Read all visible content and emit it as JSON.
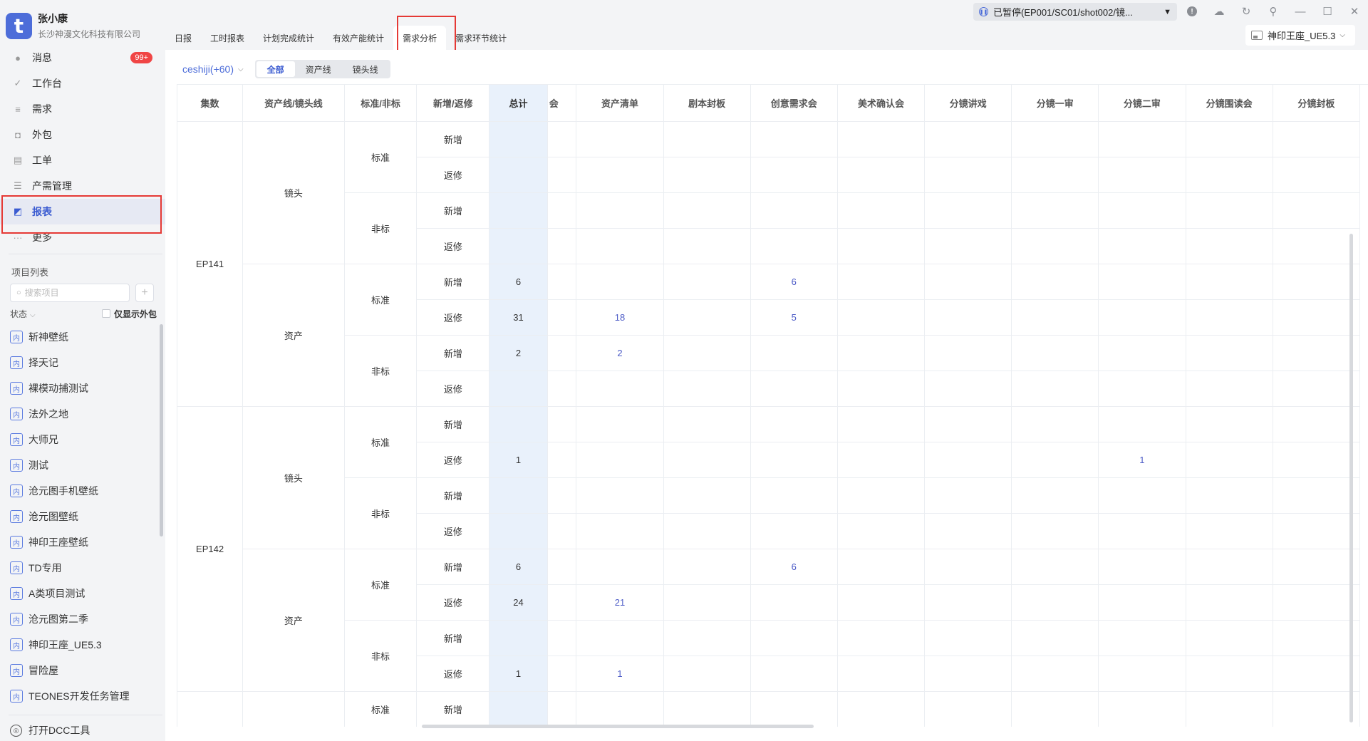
{
  "user": {
    "name": "张小康",
    "company": "长沙神漫文化科技有限公司",
    "logo_letter": "t"
  },
  "nav": [
    {
      "label": "消息",
      "icon": "message-icon",
      "badge": "99+"
    },
    {
      "label": "工作台",
      "icon": "check-icon"
    },
    {
      "label": "需求",
      "icon": "requirement-icon"
    },
    {
      "label": "外包",
      "icon": "outsource-icon"
    },
    {
      "label": "工单",
      "icon": "ticket-icon"
    },
    {
      "label": "产需管理",
      "icon": "production-icon"
    },
    {
      "label": "报表",
      "icon": "report-icon",
      "active": true
    },
    {
      "label": "更多",
      "icon": "more-icon"
    }
  ],
  "projects_panel": {
    "title": "项目列表",
    "search_placeholder": "搜索项目",
    "status_label": "状态",
    "only_outsource_label": "仅显示外包",
    "tag": "内",
    "items": [
      "斩神壁纸",
      "择天记",
      "裸模动捕测试",
      "法外之地",
      "大师兄",
      "测试",
      "沧元图手机壁纸",
      "沧元图壁纸",
      "神印王座壁纸",
      "TD专用",
      "A类项目测试",
      "沧元图第二季",
      "神印王座_UE5.3",
      "冒险屋",
      "TEONES开发任务管理"
    ]
  },
  "dcc_label": "打开DCC工具",
  "titlebar": {
    "task_status": "已暂停(EP001/SC01/shot002/镜..."
  },
  "tabs": [
    {
      "label": "日报"
    },
    {
      "label": "工时报表"
    },
    {
      "label": "计划完成统计"
    },
    {
      "label": "有效产能统计"
    },
    {
      "label": "需求分析",
      "active": true
    },
    {
      "label": "需求环节统计"
    }
  ],
  "project_select": "神印王座_UE5.3",
  "toolbar": {
    "dataset": "ceshiji(+60)",
    "segments": [
      {
        "label": "全部",
        "active": true
      },
      {
        "label": "资产线"
      },
      {
        "label": "镜头线"
      }
    ]
  },
  "table": {
    "headers": [
      "集数",
      "资产线/镜头线",
      "标准/非标",
      "新增/返修",
      "总计",
      "会",
      "资产清单",
      "剧本封板",
      "创意需求会",
      "美术确认会",
      "分镜讲戏",
      "分镜一审",
      "分镜二审",
      "分镜围读会",
      "分镜封板"
    ],
    "groups": [
      {
        "episode": "EP141",
        "lines": [
          {
            "line": "镜头",
            "stds": [
              {
                "std": "标准",
                "rows": [
                  {
                    "type": "新增",
                    "vals": [
                      "",
                      "",
                      "",
                      "",
                      "",
                      "",
                      "",
                      "",
                      "",
                      "",
                      ""
                    ]
                  },
                  {
                    "type": "返修",
                    "vals": [
                      "",
                      "",
                      "",
                      "",
                      "",
                      "",
                      "",
                      "",
                      "",
                      "",
                      ""
                    ]
                  }
                ]
              },
              {
                "std": "非标",
                "rows": [
                  {
                    "type": "新增",
                    "vals": [
                      "",
                      "",
                      "",
                      "",
                      "",
                      "",
                      "",
                      "",
                      "",
                      "",
                      ""
                    ]
                  },
                  {
                    "type": "返修",
                    "vals": [
                      "",
                      "",
                      "",
                      "",
                      "",
                      "",
                      "",
                      "",
                      "",
                      "",
                      ""
                    ]
                  }
                ]
              }
            ]
          },
          {
            "line": "资产",
            "stds": [
              {
                "std": "标准",
                "rows": [
                  {
                    "type": "新增",
                    "vals": [
                      "6",
                      "",
                      "",
                      "",
                      "6",
                      "",
                      "",
                      "",
                      "",
                      "",
                      ""
                    ]
                  },
                  {
                    "type": "返修",
                    "vals": [
                      "31",
                      "",
                      "18",
                      "",
                      "5",
                      "",
                      "",
                      "",
                      "",
                      "",
                      ""
                    ]
                  }
                ]
              },
              {
                "std": "非标",
                "rows": [
                  {
                    "type": "新增",
                    "vals": [
                      "2",
                      "",
                      "2",
                      "",
                      "",
                      "",
                      "",
                      "",
                      "",
                      "",
                      ""
                    ]
                  },
                  {
                    "type": "返修",
                    "vals": [
                      "",
                      "",
                      "",
                      "",
                      "",
                      "",
                      "",
                      "",
                      "",
                      "",
                      ""
                    ]
                  }
                ]
              }
            ]
          }
        ]
      },
      {
        "episode": "EP142",
        "lines": [
          {
            "line": "镜头",
            "stds": [
              {
                "std": "标准",
                "rows": [
                  {
                    "type": "新增",
                    "vals": [
                      "",
                      "",
                      "",
                      "",
                      "",
                      "",
                      "",
                      "",
                      "",
                      "",
                      ""
                    ]
                  },
                  {
                    "type": "返修",
                    "vals": [
                      "1",
                      "",
                      "",
                      "",
                      "",
                      "",
                      "",
                      "",
                      "1",
                      "",
                      ""
                    ]
                  }
                ]
              },
              {
                "std": "非标",
                "rows": [
                  {
                    "type": "新增",
                    "vals": [
                      "",
                      "",
                      "",
                      "",
                      "",
                      "",
                      "",
                      "",
                      "",
                      "",
                      ""
                    ]
                  },
                  {
                    "type": "返修",
                    "vals": [
                      "",
                      "",
                      "",
                      "",
                      "",
                      "",
                      "",
                      "",
                      "",
                      "",
                      ""
                    ]
                  }
                ]
              }
            ]
          },
          {
            "line": "资产",
            "stds": [
              {
                "std": "标准",
                "rows": [
                  {
                    "type": "新增",
                    "vals": [
                      "6",
                      "",
                      "",
                      "",
                      "6",
                      "",
                      "",
                      "",
                      "",
                      "",
                      ""
                    ]
                  },
                  {
                    "type": "返修",
                    "vals": [
                      "24",
                      "",
                      "21",
                      "",
                      "",
                      "",
                      "",
                      "",
                      "",
                      "",
                      ""
                    ]
                  }
                ]
              },
              {
                "std": "非标",
                "rows": [
                  {
                    "type": "新增",
                    "vals": [
                      "",
                      "",
                      "",
                      "",
                      "",
                      "",
                      "",
                      "",
                      "",
                      "",
                      ""
                    ]
                  },
                  {
                    "type": "返修",
                    "vals": [
                      "1",
                      "",
                      "1",
                      "",
                      "",
                      "",
                      "",
                      "",
                      "",
                      "",
                      ""
                    ]
                  }
                ]
              }
            ]
          }
        ]
      },
      {
        "episode": "",
        "lines": [
          {
            "line": "",
            "stds": [
              {
                "std": "标准",
                "rows": [
                  {
                    "type": "新增",
                    "vals": [
                      "",
                      "",
                      "",
                      "",
                      "",
                      "",
                      "",
                      "",
                      "",
                      "",
                      ""
                    ]
                  }
                ]
              }
            ]
          }
        ]
      }
    ]
  },
  "colors": {
    "accent": "#4d6dd9",
    "highlight": "#e53935",
    "total_column": "#e9f1fb",
    "badge": "#f04545"
  }
}
